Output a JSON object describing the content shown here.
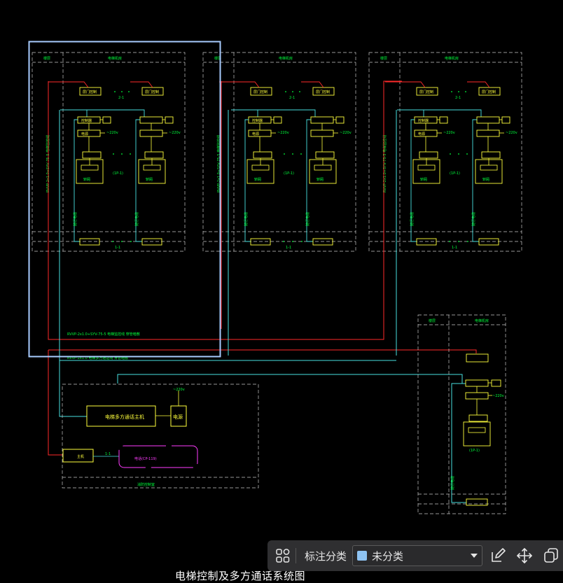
{
  "drawing": {
    "title": "电梯控制及多方通话系统图",
    "colors": {
      "background": "#000000",
      "frame": "#c8c8c8",
      "text": "#00ff3c",
      "equipment": "#ffff3c",
      "cable_red": "#ff2a2a",
      "cable_cyan": "#48e0e0",
      "pink": "#ff3cff",
      "selection": "#a8ccff"
    },
    "labels": {
      "power_220": "~220v",
      "controller": "(1P-1)",
      "phone": "电话(CP-119)",
      "master": "电梯多方通话主机",
      "supply": "电源",
      "n1": "1-1"
    }
  },
  "toolbar": {
    "select_icon": "select-group-icon",
    "category_label": "标注分类",
    "category_value": "未分类",
    "category_color": "#8ec3f2",
    "edit_icon": "edit-icon",
    "move_icon": "move-icon",
    "copy_icon": "copy-icon"
  }
}
